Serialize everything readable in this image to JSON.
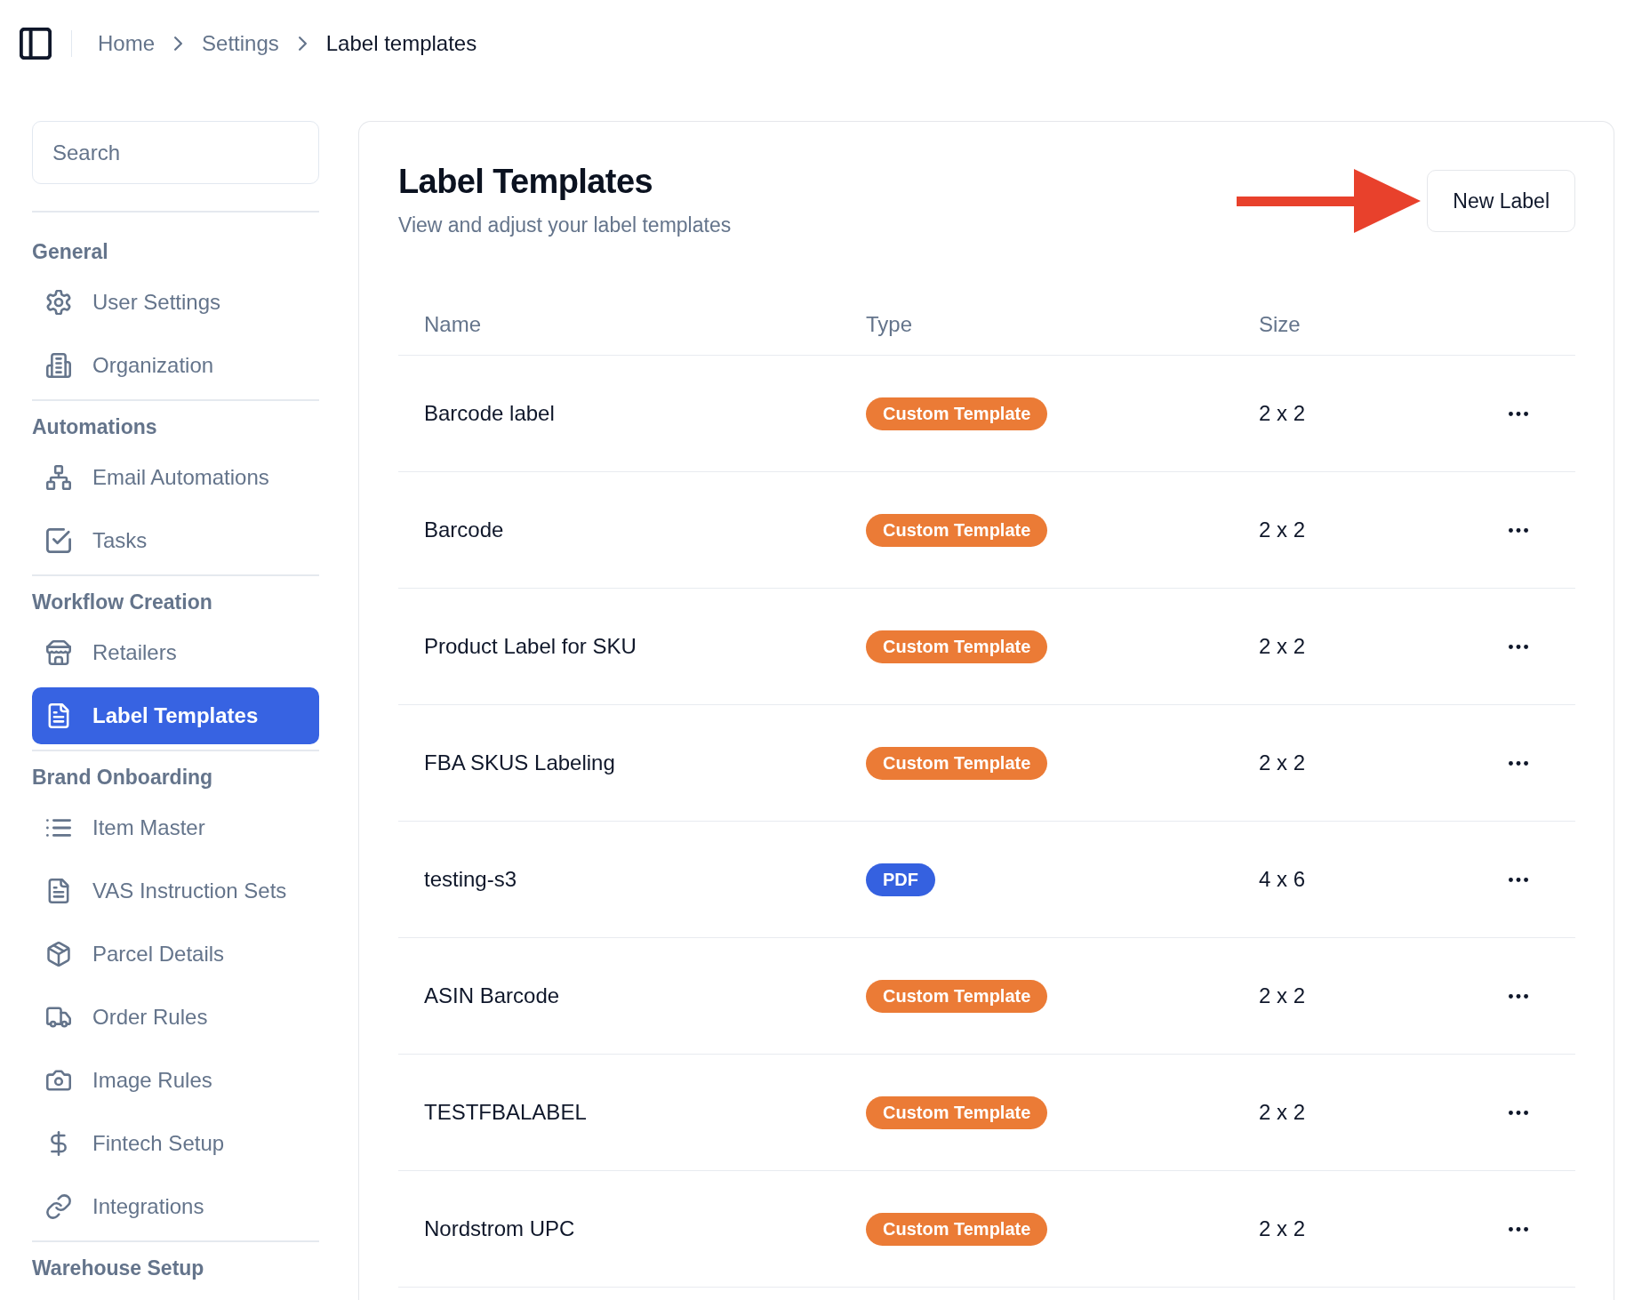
{
  "header": {
    "breadcrumbs": [
      {
        "label": "Home",
        "current": false
      },
      {
        "label": "Settings",
        "current": false
      },
      {
        "label": "Label templates",
        "current": true
      }
    ]
  },
  "sidebar": {
    "search": {
      "placeholder": "Search"
    },
    "sections": [
      {
        "title": "General",
        "items": [
          {
            "label": "User Settings",
            "selected": false
          },
          {
            "label": "Organization",
            "selected": false
          }
        ]
      },
      {
        "title": "Automations",
        "items": [
          {
            "label": "Email Automations",
            "selected": false
          },
          {
            "label": "Tasks",
            "selected": false
          }
        ]
      },
      {
        "title": "Workflow Creation",
        "items": [
          {
            "label": "Retailers",
            "selected": false
          },
          {
            "label": "Label Templates",
            "selected": true
          }
        ]
      },
      {
        "title": "Brand Onboarding",
        "items": [
          {
            "label": "Item Master",
            "selected": false
          },
          {
            "label": "VAS Instruction Sets",
            "selected": false
          },
          {
            "label": "Parcel Details",
            "selected": false
          },
          {
            "label": "Order Rules",
            "selected": false
          },
          {
            "label": "Image Rules",
            "selected": false
          },
          {
            "label": "Fintech Setup",
            "selected": false
          },
          {
            "label": "Integrations",
            "selected": false
          }
        ]
      },
      {
        "title": "Warehouse Setup"
      }
    ]
  },
  "main": {
    "title": "Label Templates",
    "subtitle": "View and adjust your label templates",
    "new_button": "New Label",
    "table": {
      "columns": [
        "Name",
        "Type",
        "Size"
      ],
      "rows": [
        {
          "name": "Barcode label",
          "type": {
            "label": "Custom Template",
            "color": "#eb7b36"
          },
          "size": "2 x 2"
        },
        {
          "name": "Barcode",
          "type": {
            "label": "Custom Template",
            "color": "#eb7b36"
          },
          "size": "2 x 2"
        },
        {
          "name": "Product Label for SKU",
          "type": {
            "label": "Custom Template",
            "color": "#eb7b36"
          },
          "size": "2 x 2"
        },
        {
          "name": "FBA SKUS Labeling",
          "type": {
            "label": "Custom Template",
            "color": "#eb7b36"
          },
          "size": "2 x 2"
        },
        {
          "name": "testing-s3",
          "type": {
            "label": "PDF",
            "color": "#3561e0"
          },
          "size": "4 x 6"
        },
        {
          "name": "ASIN Barcode",
          "type": {
            "label": "Custom Template",
            "color": "#eb7b36"
          },
          "size": "2 x 2"
        },
        {
          "name": "TESTFBALABEL",
          "type": {
            "label": "Custom Template",
            "color": "#eb7b36"
          },
          "size": "2 x 2"
        },
        {
          "name": "Nordstrom UPC",
          "type": {
            "label": "Custom Template",
            "color": "#eb7b36"
          },
          "size": "2 x 2"
        }
      ]
    }
  }
}
